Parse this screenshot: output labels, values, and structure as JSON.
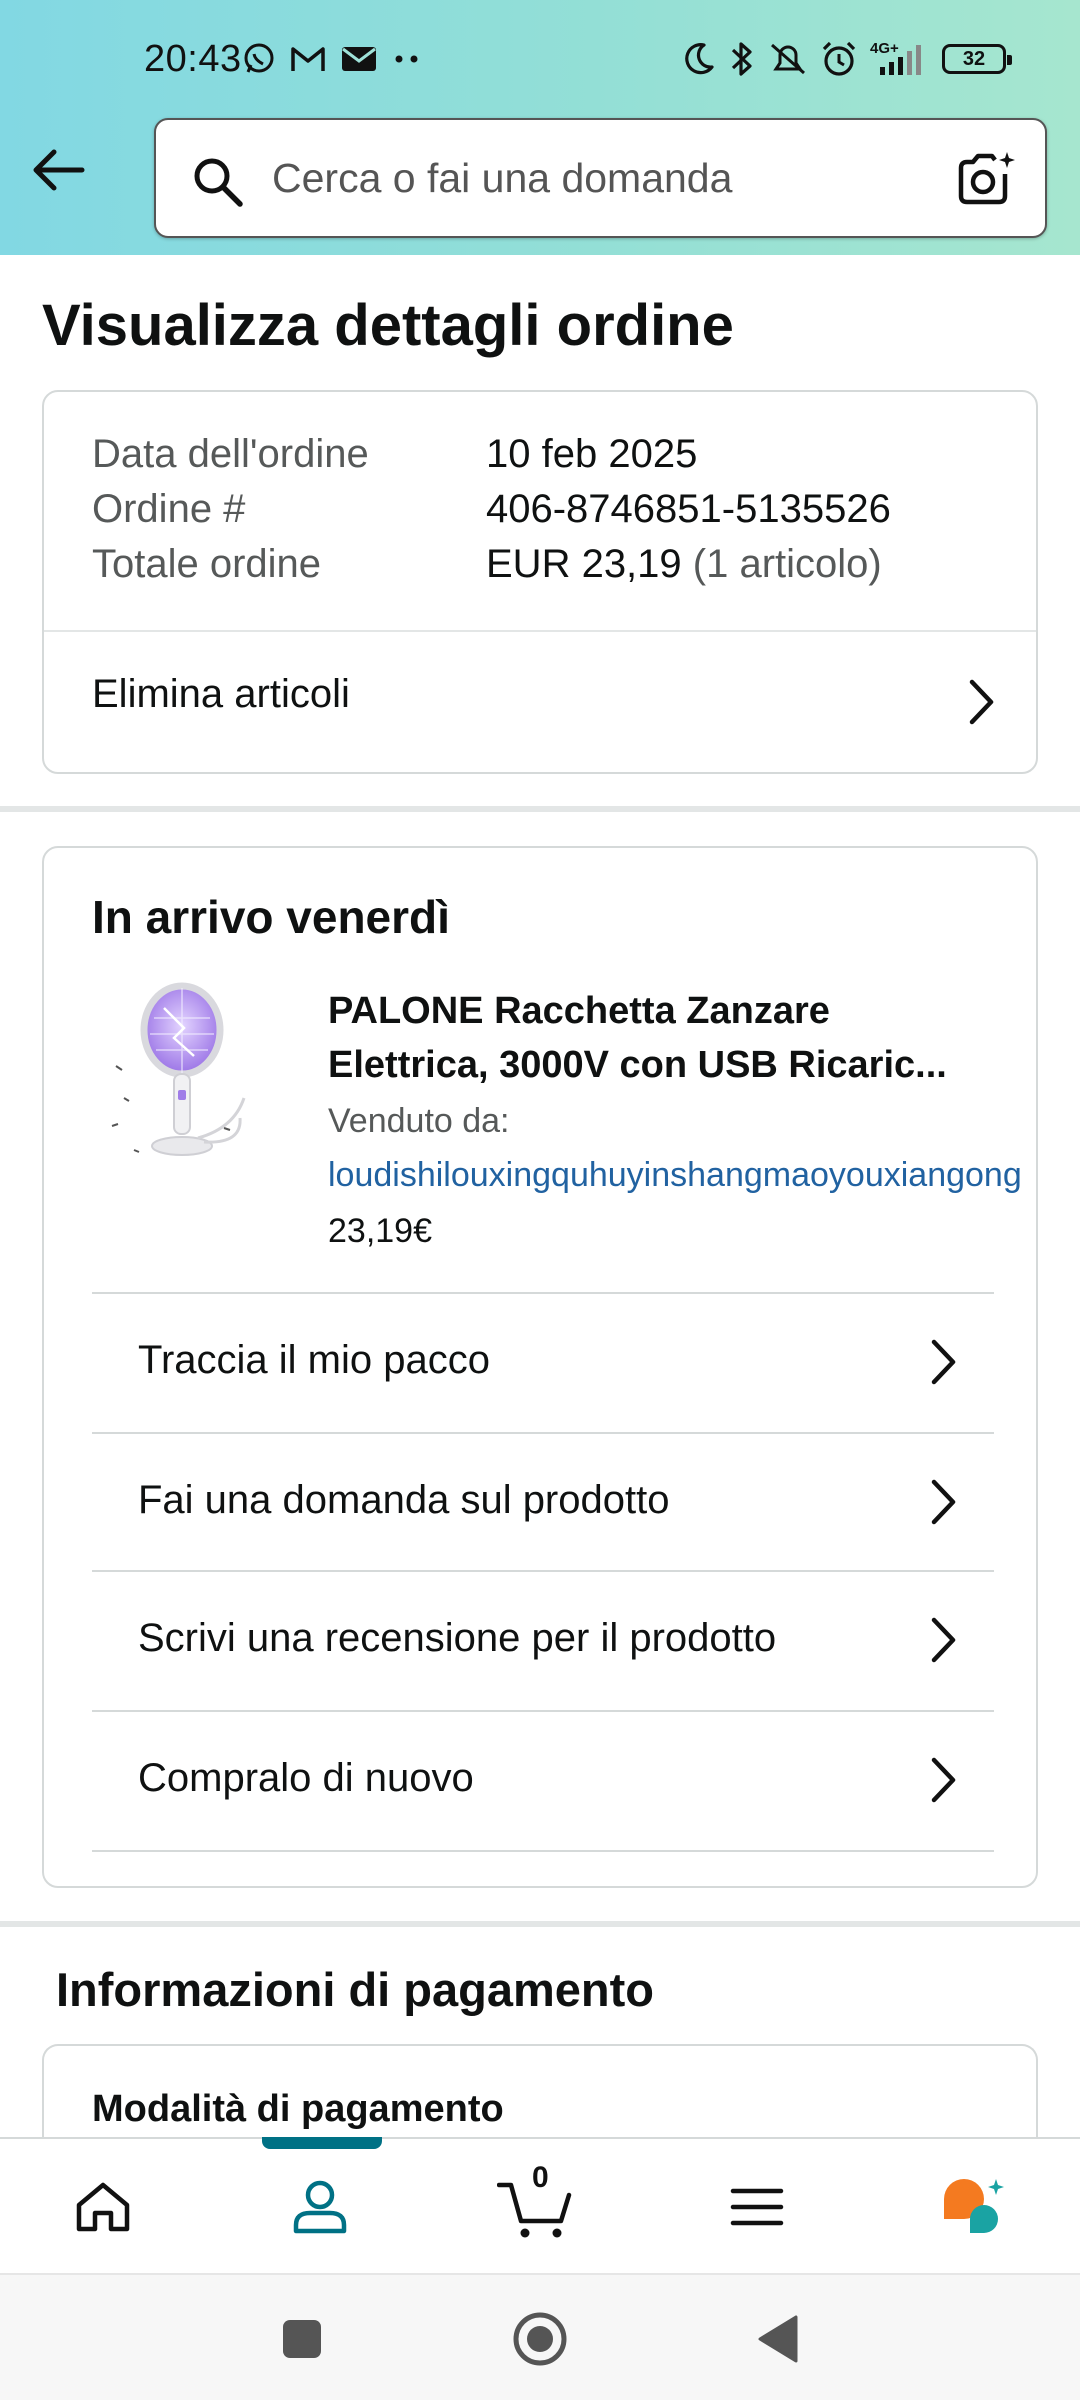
{
  "status_bar": {
    "time": "20:43",
    "network_label": "4G+",
    "battery": "32"
  },
  "search": {
    "placeholder": "Cerca o fai una domanda"
  },
  "page_title": "Visualizza dettagli ordine",
  "order": {
    "date_label": "Data dell'ordine",
    "date_value": "10 feb 2025",
    "number_label": "Ordine #",
    "number_value": "406-8746851-5135526",
    "total_label": "Totale ordine",
    "total_value": "EUR 23,19",
    "total_items": "(1 articolo)",
    "delete_items_label": "Elimina articoli"
  },
  "shipment": {
    "arrival_title": "In arrivo venerdì",
    "product_name_line1": "PALONE Racchetta Zanzare",
    "product_name_line2": "Elettrica, 3000V con USB Ricaric...",
    "sold_by_label": "Venduto da:",
    "seller": "loudishilouxingquhuyinshangmaoyouxiangong",
    "price": "23,19€",
    "actions": [
      {
        "label": "Traccia il mio pacco"
      },
      {
        "label": "Fai una domanda sul prodotto"
      },
      {
        "label": "Scrivi una recensione per il prodotto"
      },
      {
        "label": "Compralo di nuovo"
      }
    ]
  },
  "payment": {
    "section_title": "Informazioni di pagamento",
    "method_label": "Modalità di pagamento"
  },
  "bottom_nav": {
    "cart_count": "0",
    "active_tab": "account",
    "accent_color": "#007185"
  },
  "colors": {
    "header_gradient_start": "#82d8e3",
    "header_gradient_end": "#a6e6cf",
    "link": "#2162a1",
    "rufus_orange": "#f47a20",
    "rufus_teal": "#1aa3a3"
  }
}
